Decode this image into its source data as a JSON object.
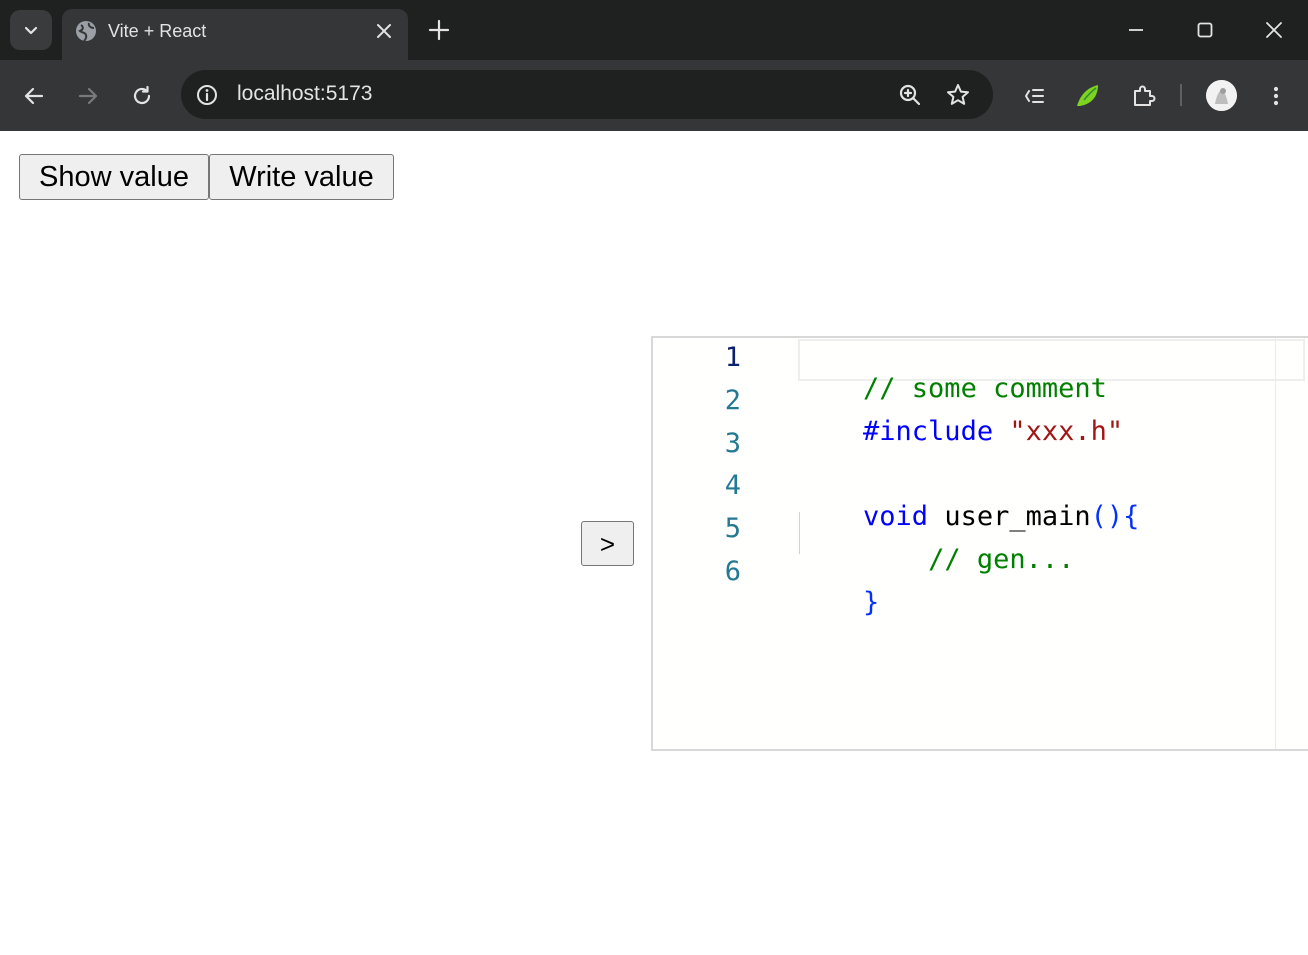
{
  "browser": {
    "tab": {
      "title": "Vite + React",
      "favicon": "globe-icon"
    },
    "address": {
      "url": "localhost:5173"
    },
    "icons": {
      "tab_search": "chevron-down-icon",
      "close_tab": "close-icon",
      "new_tab": "plus-icon",
      "back": "arrow-left-icon",
      "forward": "arrow-right-icon",
      "reload": "reload-icon",
      "site_info": "info-icon",
      "zoom": "zoom-in-icon",
      "bookmark": "star-icon",
      "reading_list": "list-icon",
      "extension": "leaf-icon",
      "extensions": "puzzle-icon",
      "profile": "avatar",
      "menu": "kebab-menu-icon",
      "minimize": "minimize-icon",
      "maximize": "maximize-icon",
      "close_window": "close-icon"
    },
    "colors": {
      "titlebar": "#1f2020",
      "toolbar": "#353637",
      "omnibox": "#1f2020",
      "extension_leaf": "#7ed321"
    }
  },
  "page": {
    "buttons": {
      "show_value": "Show value",
      "write_value": "Write value",
      "arrow": ">"
    },
    "editor": {
      "line_numbers": [
        "1",
        "2",
        "3",
        "4",
        "5",
        "6"
      ],
      "active_line": 1,
      "lines": [
        [
          {
            "text": "// some comment",
            "type": "comment"
          }
        ],
        [
          {
            "text": "#include ",
            "type": "keyword"
          },
          {
            "text": "\"xxx.h\"",
            "type": "string"
          }
        ],
        [],
        [
          {
            "text": "void",
            "type": "keyword"
          },
          {
            "text": " user_main",
            "type": "plain"
          },
          {
            "text": "(){",
            "type": "bracket"
          }
        ],
        [
          {
            "text": "    ",
            "type": "plain"
          },
          {
            "text": "// gen...",
            "type": "comment"
          }
        ],
        [
          {
            "text": "}",
            "type": "bracket"
          }
        ]
      ],
      "colors": {
        "comment": "#008000",
        "keyword": "#0000ff",
        "string": "#a31515",
        "plain": "#000000",
        "bracket": "#0431fa",
        "line_number": "#237893",
        "active_line_number": "#0b216f"
      }
    }
  }
}
